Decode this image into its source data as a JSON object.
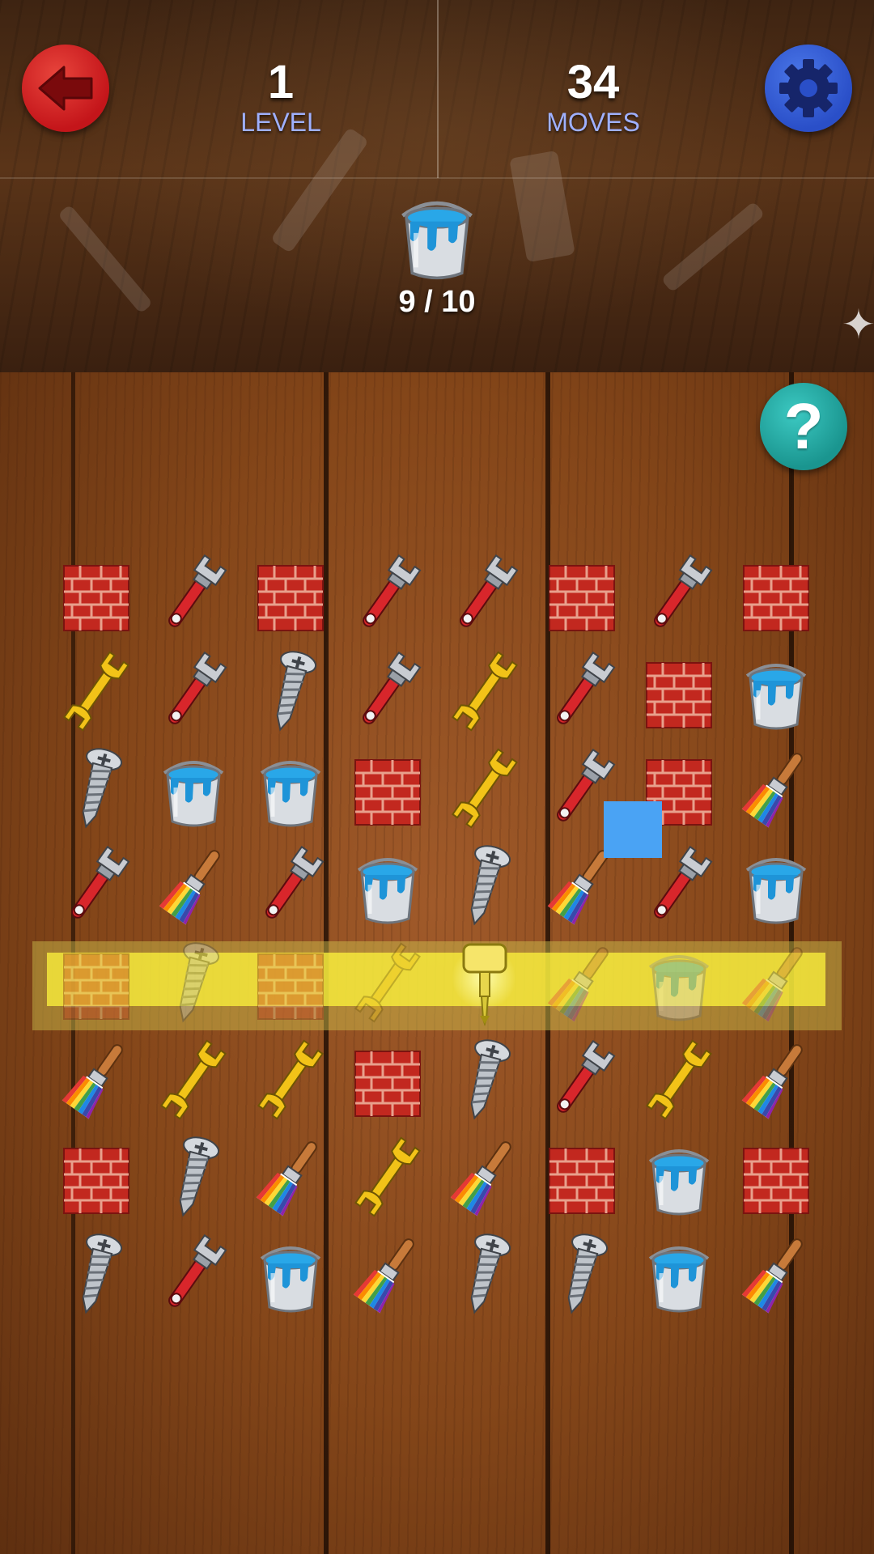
{
  "hud": {
    "level_value": "1",
    "level_label": "LEVEL",
    "moves_value": "34",
    "moves_label": "MOVES",
    "goal_icon": "paint-bucket-icon",
    "goal_progress": "9 / 10",
    "help_glyph": "?"
  },
  "buttons": {
    "back_icon": "back-arrow-icon",
    "settings_icon": "gear-icon",
    "help_icon": "question-mark-icon"
  },
  "colors": {
    "back_button": "#c4151a",
    "settings_button": "#2a4fc8",
    "help_button": "#1a958f",
    "label_blue": "#9fb0ff",
    "highlight_yellow": "#fff53c",
    "selection_blue": "#4aa3f4"
  },
  "board": {
    "rows": [
      [
        "brick",
        "red-wrench",
        "brick",
        "red-wrench",
        "red-wrench",
        "brick",
        "red-wrench",
        "brick"
      ],
      [
        "yellow-wrench",
        "red-wrench",
        "screw",
        "red-wrench",
        "yellow-wrench",
        "red-wrench",
        "brick",
        "bucket"
      ],
      [
        "screw",
        "bucket",
        "bucket",
        "brick",
        "yellow-wrench",
        "red-wrench",
        "brick",
        "brush"
      ],
      [
        "red-wrench",
        "brush",
        "red-wrench",
        "bucket",
        "screw",
        "brush",
        "red-wrench",
        "bucket"
      ],
      [
        "brick",
        "screw",
        "brick",
        "yellow-wrench",
        "drill",
        "brush",
        "bucket",
        "brush"
      ],
      [
        "brush",
        "yellow-wrench",
        "yellow-wrench",
        "brick",
        "screw",
        "red-wrench",
        "yellow-wrench",
        "brush"
      ],
      [
        "brick",
        "screw",
        "brush",
        "yellow-wrench",
        "brush",
        "brick",
        "bucket",
        "brick"
      ],
      [
        "screw",
        "red-wrench",
        "bucket",
        "brush",
        "screw",
        "screw",
        "bucket",
        "brush"
      ]
    ],
    "highlighted_row": 4,
    "powerup": "drill-icon"
  }
}
